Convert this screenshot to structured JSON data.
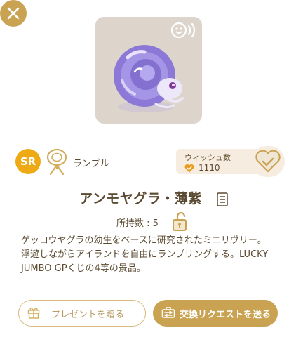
{
  "item": {
    "name": "アンモヤグラ・薄紫",
    "rarity": "SR",
    "category": "ランブル",
    "owned_label": "所持数 : 5",
    "description": "ゲッコウヤグラの幼生をベースに研究されたミニリヴリー。浮遊しながらアイランドを自由にランブリングする。LUCKY JUMBO GPくじの4等の景品。"
  },
  "wish": {
    "label": "ウィッシュ数",
    "count": "1110"
  },
  "actions": {
    "gift_label": "プレゼントを贈る",
    "trade_label": "交換リクエストを送る"
  },
  "icons": {
    "close": "close-icon",
    "voice": "voice-icon",
    "category": "rumble-icon",
    "document": "document-icon",
    "lock": "unlock-icon",
    "gift": "gift-icon",
    "trade": "exchange-icon"
  },
  "colors": {
    "accent": "#c9a252",
    "rarity": "#eeaa14",
    "text": "#5b4a32",
    "card_bg": "#ddd4cb",
    "wish_bg": "#f6ede0"
  }
}
